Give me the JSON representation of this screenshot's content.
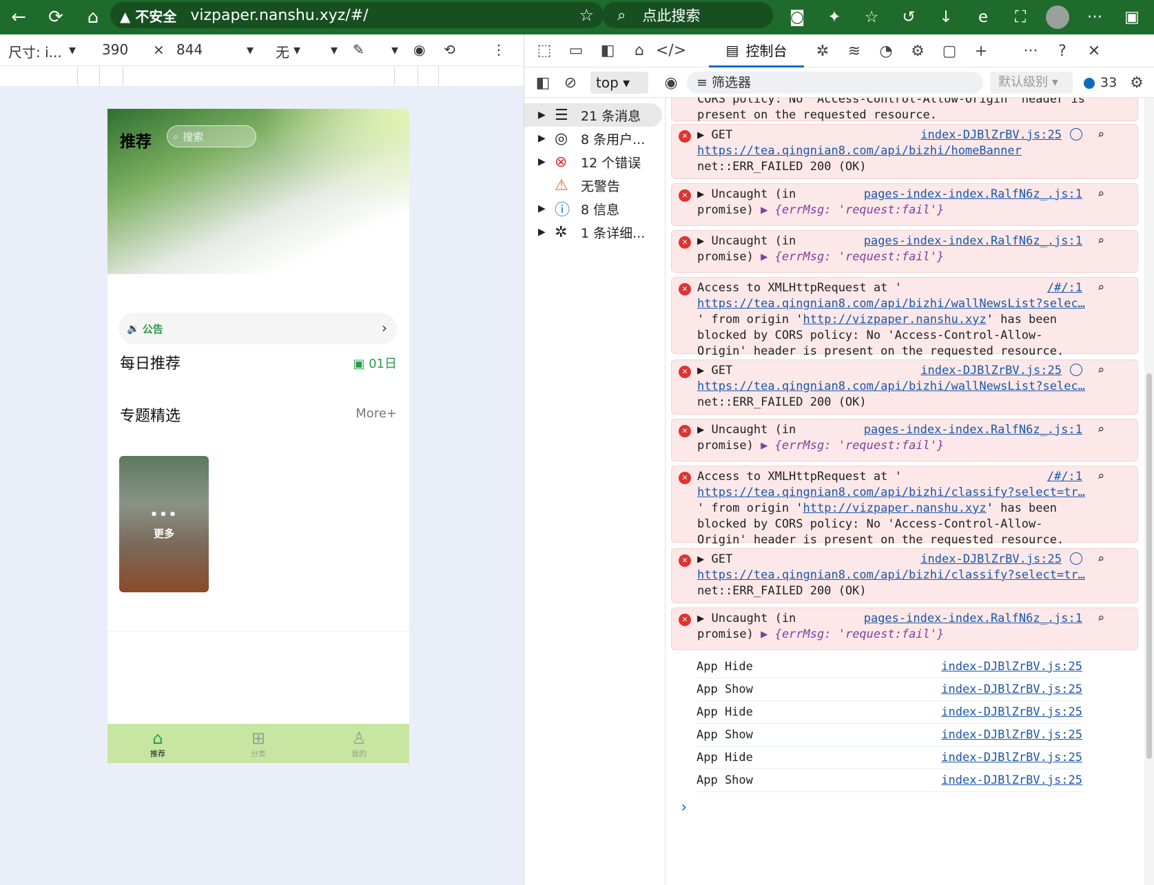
{
  "browser": {
    "security_label": "不安全",
    "url": "vizpaper.nanshu.xyz/#/",
    "search_placeholder": "点此搜索"
  },
  "devbar": {
    "size_label": "尺寸: i...",
    "width": "390",
    "times": "×",
    "height": "844",
    "throttle": "无"
  },
  "phone": {
    "title": "推荐",
    "search_placeholder": "搜索",
    "notice_label": "公告",
    "daily_title": "每日推荐",
    "daily_date": "01日",
    "topics_title": "专题精选",
    "topics_more": "More+",
    "card_dots": "•••",
    "card_label": "更多",
    "tabs": [
      {
        "label": "推荐",
        "active": true
      },
      {
        "label": "分类",
        "active": false
      },
      {
        "label": "我的",
        "active": false
      }
    ]
  },
  "devtools": {
    "active_tab": "控制台",
    "context": "top",
    "filter": "筛选器",
    "level": "默认级别",
    "message_count": "33",
    "sidebar": [
      {
        "label": "21 条消息",
        "icon": "list-icon"
      },
      {
        "label": "8 条用户...",
        "icon": "user-icon"
      },
      {
        "label": "12 个错误",
        "icon": "error-icon"
      },
      {
        "label": "无警告",
        "icon": "warning-icon"
      },
      {
        "label": "8 信息",
        "icon": "info-icon"
      },
      {
        "label": "1 条详细...",
        "icon": "bug-icon"
      }
    ]
  },
  "console": {
    "partial_top": "CORS policy: No 'Access-Control-Allow-Origin' header is",
    "partial_bottom": "present on the requested resource.",
    "entries": [
      {
        "head": "▶ GET",
        "src": "index-DJBlZrBV.js:25",
        "link": "https://tea.qingnian8.com/api/bizhi/homeBanner",
        "tail": "net::ERR_FAILED 200 (OK)"
      },
      {
        "head": "▶ Uncaught (in",
        "src": "pages-index-index.RalfN6z_.js:1",
        "line2": "promise)",
        "obj": "▶ {errMsg: 'request:fail'}"
      },
      {
        "head": "▶ Uncaught (in",
        "src": "pages-index-index.RalfN6z_.js:1",
        "line2": "promise)",
        "obj": "▶ {errMsg: 'request:fail'}"
      },
      {
        "head": "Access to XMLHttpRequest at '",
        "src": "/#/:1",
        "link": "https://tea.qingnian8.com/api/bizhi/wallNewsList?selec…",
        "l3a": "' from origin '",
        "origin": "http://vizpaper.nanshu.xyz",
        "l3b": "' has been",
        "l4": "blocked by CORS policy: No 'Access-Control-Allow-",
        "l5": "Origin' header is present on the requested resource."
      },
      {
        "head": "▶ GET",
        "src": "index-DJBlZrBV.js:25",
        "link": "https://tea.qingnian8.com/api/bizhi/wallNewsList?selec…",
        "tail": "net::ERR_FAILED 200 (OK)"
      },
      {
        "head": "▶ Uncaught (in",
        "src": "pages-index-index.RalfN6z_.js:1",
        "line2": "promise)",
        "obj": "▶ {errMsg: 'request:fail'}"
      },
      {
        "head": "Access to XMLHttpRequest at '",
        "src": "/#/:1",
        "link": "https://tea.qingnian8.com/api/bizhi/classify?select=tr…",
        "l3a": "' from origin '",
        "origin": "http://vizpaper.nanshu.xyz",
        "l3b": "' has been",
        "l4": "blocked by CORS policy: No 'Access-Control-Allow-",
        "l5": "Origin' header is present on the requested resource."
      },
      {
        "head": "▶ GET",
        "src": "index-DJBlZrBV.js:25",
        "link": "https://tea.qingnian8.com/api/bizhi/classify?select=tr…",
        "tail": "net::ERR_FAILED 200 (OK)"
      },
      {
        "head": "▶ Uncaught (in",
        "src": "pages-index-index.RalfN6z_.js:1",
        "line2": "promise)",
        "obj": "▶ {errMsg: 'request:fail'}"
      }
    ],
    "logs": [
      {
        "text": "App Hide",
        "src": "index-DJBlZrBV.js:25"
      },
      {
        "text": "App Show",
        "src": "index-DJBlZrBV.js:25"
      },
      {
        "text": "App Hide",
        "src": "index-DJBlZrBV.js:25"
      },
      {
        "text": "App Show",
        "src": "index-DJBlZrBV.js:25"
      },
      {
        "text": "App Hide",
        "src": "index-DJBlZrBV.js:25"
      },
      {
        "text": "App Show",
        "src": "index-DJBlZrBV.js:25"
      }
    ],
    "prompt": "›"
  }
}
